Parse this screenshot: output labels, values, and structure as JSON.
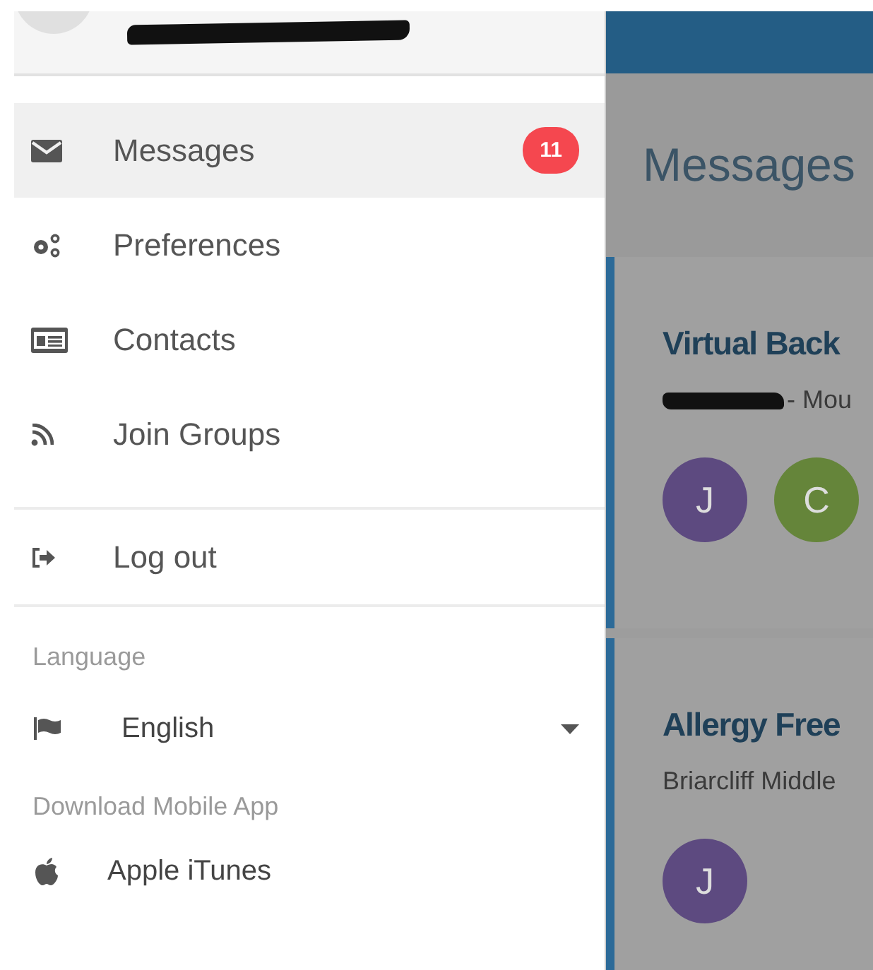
{
  "account": {
    "email_redacted": true
  },
  "drawer": {
    "nav": [
      {
        "label": "Messages",
        "selected": true,
        "badge": "11"
      },
      {
        "label": "Preferences",
        "selected": false
      },
      {
        "label": "Contacts",
        "selected": false
      },
      {
        "label": "Join Groups",
        "selected": false
      }
    ],
    "logout": {
      "label": "Log out"
    },
    "language_label": "Language",
    "language_select": {
      "value": "English"
    },
    "download_label": "Download Mobile App",
    "app_link": {
      "label": "Apple iTunes"
    }
  },
  "main": {
    "heading": "Messages",
    "cards": [
      {
        "title": "Virtual Back",
        "sender_redacted": true,
        "subtitle": "- Mou",
        "participants": [
          {
            "initial": "J",
            "color": "#5d4a80"
          },
          {
            "initial": "C",
            "color": "#65853a"
          }
        ]
      },
      {
        "title": "Allergy Free",
        "sender_redacted": false,
        "subtitle": "Briarcliff Middle",
        "participants": [
          {
            "initial": "J",
            "color": "#5d4a80"
          }
        ]
      }
    ]
  }
}
